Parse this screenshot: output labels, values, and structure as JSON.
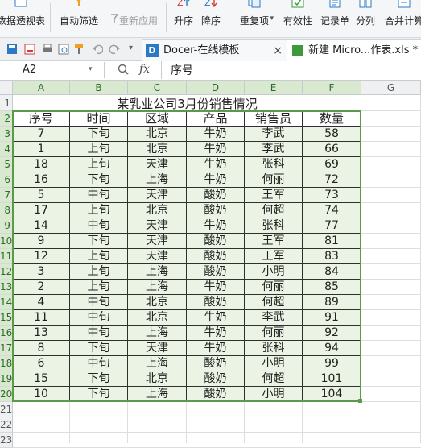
{
  "ribbon": {
    "pivot_label": "数据透视表",
    "autofilter_label": "自动筛选",
    "reapply_label": "重新应用",
    "sort_asc_label": "升序",
    "sort_desc_label": "降序",
    "duplicates_label": "重复项",
    "validity_label": "有效性",
    "record_label": "记录单",
    "split_label": "分列",
    "merge_calc_label": "合并计算"
  },
  "tabs": [
    {
      "label": "Docer-在线模板",
      "icon": "docer-icon"
    },
    {
      "label": "新建 Micro...作表.xls *",
      "icon": "spreadsheet-icon"
    }
  ],
  "formula_bar": {
    "cell_ref": "A2",
    "fx_label": "fx",
    "value": "序号"
  },
  "columns": [
    "A",
    "B",
    "C",
    "D",
    "E",
    "F",
    "G"
  ],
  "row_numbers": [
    "1",
    "2",
    "3",
    "4",
    "5",
    "6",
    "7",
    "8",
    "9",
    "10",
    "11",
    "12",
    "13",
    "14",
    "15",
    "16",
    "17",
    "18",
    "19",
    "20",
    "21",
    "22",
    "23"
  ],
  "sheet": {
    "title": "某乳业公司3月份销售情况",
    "headers": [
      "序号",
      "时间",
      "区域",
      "产品",
      "销售员",
      "数量"
    ],
    "rows": [
      [
        "7",
        "下旬",
        "北京",
        "牛奶",
        "李武",
        "58"
      ],
      [
        "1",
        "上旬",
        "北京",
        "牛奶",
        "李武",
        "66"
      ],
      [
        "18",
        "上旬",
        "天津",
        "牛奶",
        "张科",
        "69"
      ],
      [
        "16",
        "下旬",
        "上海",
        "牛奶",
        "何丽",
        "72"
      ],
      [
        "5",
        "中旬",
        "天津",
        "酸奶",
        "王军",
        "73"
      ],
      [
        "17",
        "上旬",
        "北京",
        "酸奶",
        "何超",
        "74"
      ],
      [
        "14",
        "中旬",
        "天津",
        "牛奶",
        "张科",
        "77"
      ],
      [
        "9",
        "下旬",
        "天津",
        "酸奶",
        "王军",
        "81"
      ],
      [
        "12",
        "上旬",
        "天津",
        "酸奶",
        "王军",
        "83"
      ],
      [
        "3",
        "上旬",
        "上海",
        "酸奶",
        "小明",
        "84"
      ],
      [
        "2",
        "上旬",
        "上海",
        "牛奶",
        "何丽",
        "85"
      ],
      [
        "4",
        "中旬",
        "北京",
        "酸奶",
        "何超",
        "89"
      ],
      [
        "11",
        "中旬",
        "北京",
        "牛奶",
        "李武",
        "91"
      ],
      [
        "13",
        "中旬",
        "上海",
        "牛奶",
        "何丽",
        "92"
      ],
      [
        "8",
        "下旬",
        "天津",
        "牛奶",
        "张科",
        "94"
      ],
      [
        "6",
        "中旬",
        "上海",
        "酸奶",
        "小明",
        "99"
      ],
      [
        "15",
        "下旬",
        "北京",
        "酸奶",
        "何超",
        "101"
      ],
      [
        "10",
        "下旬",
        "上海",
        "酸奶",
        "小明",
        "104"
      ]
    ]
  },
  "colors": {
    "selection_fill": "#eaf3e4",
    "selection_border": "#5b9a4a",
    "header_highlight": "#d9e9d0"
  }
}
